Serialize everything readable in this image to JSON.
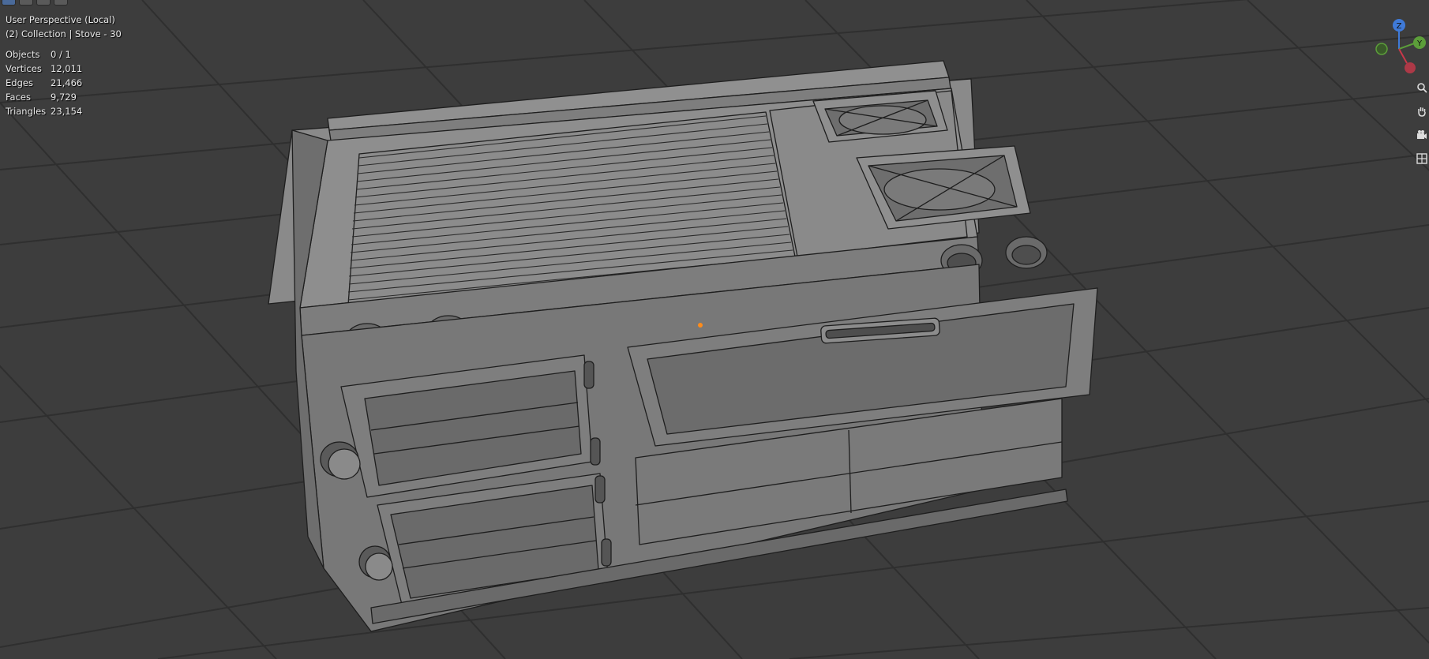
{
  "viewport": {
    "view_name": "User Perspective (Local)",
    "collection_line": "(2) Collection | Stove - 30",
    "stats": [
      {
        "label": "Objects",
        "value": "0 / 1"
      },
      {
        "label": "Vertices",
        "value": "12,011"
      },
      {
        "label": "Edges",
        "value": "21,466"
      },
      {
        "label": "Faces",
        "value": "9,729"
      },
      {
        "label": "Triangles",
        "value": "23,154"
      }
    ]
  },
  "gizmo": {
    "z_label": "Z",
    "y_label": "Y",
    "colors": {
      "x": "#c9384a",
      "y": "#5c9e3a",
      "z": "#3f7ad8"
    }
  },
  "side_tools": [
    "zoom-icon",
    "hand-pan-icon",
    "camera-icon",
    "grid-view-icon"
  ],
  "colors": {
    "background": "#3d3d3d",
    "grid_line": "#2f2f2f",
    "mesh_top": "#8c8c8c",
    "mesh_front": "#757575",
    "mesh_edge": "#1e1e1e",
    "origin_dot": "#ff8c1a"
  }
}
